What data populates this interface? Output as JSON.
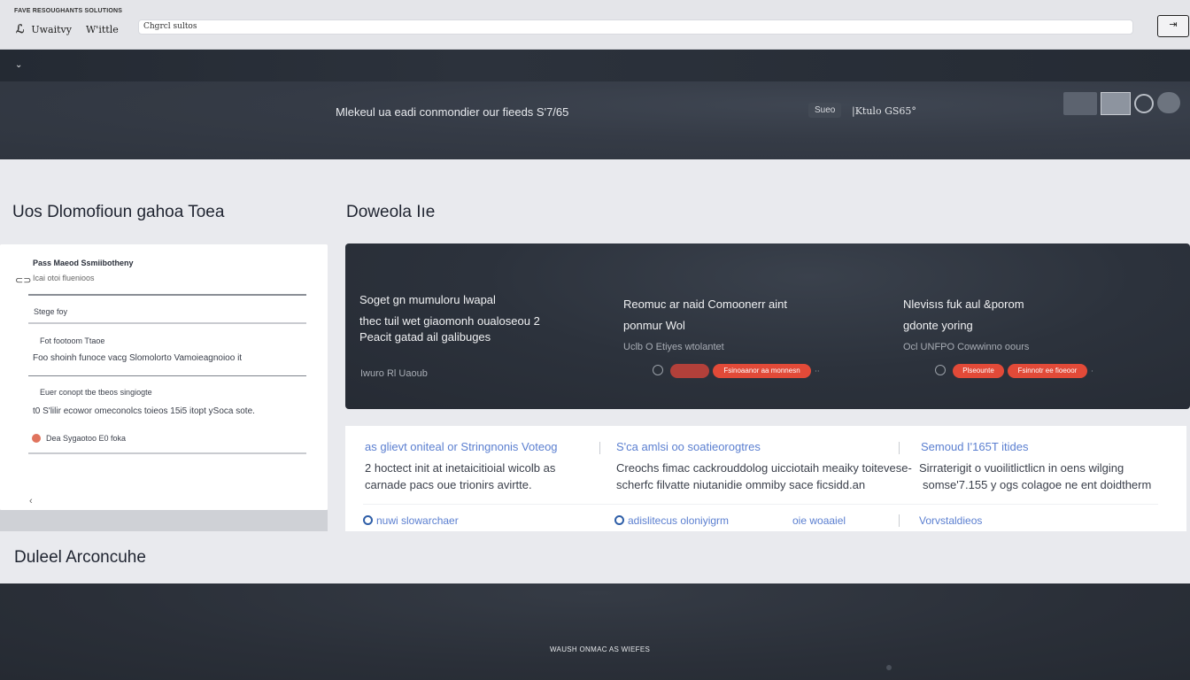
{
  "topbar": {
    "brand_tag": "FAVE RESOUGHANTS SOLUTIONS",
    "brand_logo": "ℒ",
    "brand_name": "Uwaitvy",
    "brand_name2": "W'ittle",
    "address_value": "Chgrcl sultos",
    "action_icon": "⇥"
  },
  "nav": {
    "toggle_icon": "chevron-down-icon",
    "toggle_glyph": "⌄"
  },
  "hero": {
    "headline": "Mlekeul ua eadi conmondier our fieeds S'7/65",
    "chip": "Sueo",
    "sub": "|Ktulo GS65°"
  },
  "sections": {
    "left_heading": "Uos Dlomofioun gahoa Toea",
    "right_heading": "Doweola Iıe",
    "bottom_heading": "Duleel Arconcuhe"
  },
  "left_card": {
    "title": "Pass Maeod Ssmiibotheny",
    "subtitle": "Icai otoi fluenioos",
    "label1": "Stege foy",
    "label2": "Fot footoom Ttaoe",
    "text1": "Foo shoinh funoce vacg Slomolorto Vamoieagnoioo it",
    "label3": "Euer conopt tbe tbeos singiogte",
    "text2": "t0 S'lilir ecowor omeconolcs toieos 15i5 itopt ySoca sote.",
    "label4": "Dea Sygaotoo E0 foka",
    "badge_icon": "user-icon",
    "bottom_icon": "back-icon"
  },
  "banner": {
    "col1": {
      "line1": "Soget gn mumuloru lwapal",
      "line2": "thec tuil wet giaomonh oualoseou 2",
      "line3": "Peacit gatad ail galibuges",
      "meta": "Iwuro Rl Uaoub"
    },
    "col2": {
      "line1": "Reomuc ar naid Comoonerr aint",
      "line2": "ponmur Wol",
      "meta": "Uclb O Etiyes wtolantet",
      "button1": "",
      "button2": "Fsinoaanor aa monnesn"
    },
    "col3": {
      "line1": "Nlevisıs fuk aul &porom",
      "line2": "gdonte yoring",
      "meta": "Ocl UNFPO Cowwinno oours",
      "button1": "Plseounte",
      "button2": "Fsinnotr ee fioeoor"
    }
  },
  "info": {
    "col1": {
      "head": "as glievt oniteal or Stringnonis Voteog",
      "text1": "2 hoctect init at inetaicitioial wicolb as",
      "text2": "carnade pacs oue trionirs avirtte.",
      "link": "nuwi slowarchaer"
    },
    "col2": {
      "head": "S'ca amlsi oo soatieorogtres",
      "text1": "Creochs fimac cackrouddolog uicciotaih meaiky toitevese-",
      "text2": "scherfc filvatte niutanidie ommiby sace ficsidd.an",
      "link": "adislitecus oloniyigrm",
      "link2": "oie woaaiel"
    },
    "col3": {
      "head": "Semoud I'165T itides",
      "text1": "Sirraterigit o vuoilitlictlicn in oens wilging",
      "text2": "somse'7.155 y ogs colagoe ne ent doidtherm",
      "link": "Vorvstaldieos"
    }
  },
  "footer": {
    "text": "WAUSH ONMAC AS WIEFES"
  },
  "colors": {
    "accent_red": "#e24a38",
    "link_blue": "#5b7fd0",
    "dark_bg": "#2c323c"
  }
}
